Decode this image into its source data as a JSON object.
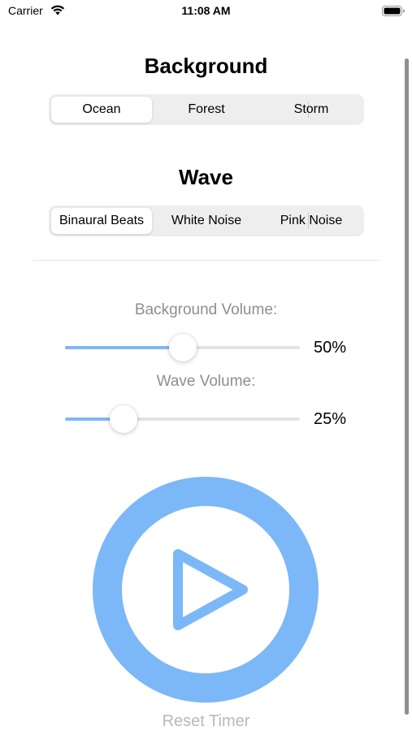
{
  "status_bar": {
    "carrier": "Carrier",
    "time": "11:08 AM",
    "icons": [
      "wifi-icon",
      "battery-icon"
    ]
  },
  "background": {
    "title": "Background",
    "options": [
      "Ocean",
      "Forest",
      "Storm"
    ],
    "selected": "Ocean"
  },
  "wave": {
    "title": "Wave",
    "options": [
      "Binaural Beats",
      "White Noise",
      "Pink Noise"
    ],
    "selected": "Binaural Beats"
  },
  "background_volume": {
    "label": "Background Volume:",
    "value": 0.5,
    "value_text": "50%"
  },
  "wave_volume": {
    "label": "Wave Volume:",
    "value": 0.25,
    "value_text": "25%"
  },
  "player": {
    "icon": "play-icon",
    "reset_label": "Reset Timer"
  },
  "colors": {
    "accent": "#7cb8f7",
    "secondary_text": "#8e8e93",
    "disabled_text": "#b8b8bc"
  }
}
